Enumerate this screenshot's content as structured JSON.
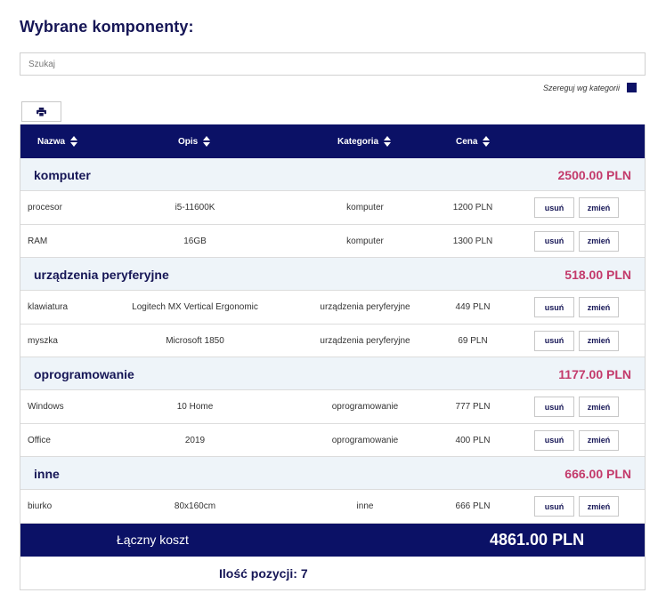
{
  "page": {
    "title": "Wybrane komponenty:"
  },
  "search": {
    "placeholder": "Szukaj"
  },
  "sort_by_category": {
    "label": "Szereguj wg kategorii"
  },
  "toolbar": {
    "print_icon": "print-icon"
  },
  "table": {
    "headers": {
      "name": "Nazwa",
      "description": "Opis",
      "category": "Kategoria",
      "price": "Cena"
    },
    "groups": [
      {
        "name": "komputer",
        "total": "2500.00 PLN",
        "items": [
          {
            "name": "procesor",
            "description": "i5-11600K",
            "category": "komputer",
            "price": "1200 PLN"
          },
          {
            "name": "RAM",
            "description": "16GB",
            "category": "komputer",
            "price": "1300 PLN"
          }
        ]
      },
      {
        "name": "urządzenia peryferyjne",
        "total": "518.00 PLN",
        "items": [
          {
            "name": "klawiatura",
            "description": "Logitech MX Vertical Ergonomic",
            "category": "urządzenia peryferyjne",
            "price": "449 PLN"
          },
          {
            "name": "myszka",
            "description": "Microsoft 1850",
            "category": "urządzenia peryferyjne",
            "price": "69 PLN"
          }
        ]
      },
      {
        "name": "oprogramowanie",
        "total": "1177.00 PLN",
        "items": [
          {
            "name": "Windows",
            "description": "10 Home",
            "category": "oprogramowanie",
            "price": "777 PLN"
          },
          {
            "name": "Office",
            "description": "2019",
            "category": "oprogramowanie",
            "price": "400 PLN"
          }
        ]
      },
      {
        "name": "inne",
        "total": "666.00 PLN",
        "items": [
          {
            "name": "biurko",
            "description": "80x160cm",
            "category": "inne",
            "price": "666 PLN"
          }
        ]
      }
    ],
    "buttons": {
      "delete": "usuń",
      "edit": "zmień"
    }
  },
  "summary": {
    "total_label": "Łączny koszt",
    "total_value": "4861.00 PLN",
    "count_label": "Ilość pozycji:",
    "count_value": "7"
  },
  "colors": {
    "navy": "#0b1166",
    "category_bg": "#eef4f9",
    "total_pink": "#c33a6b",
    "heading": "#161656"
  }
}
